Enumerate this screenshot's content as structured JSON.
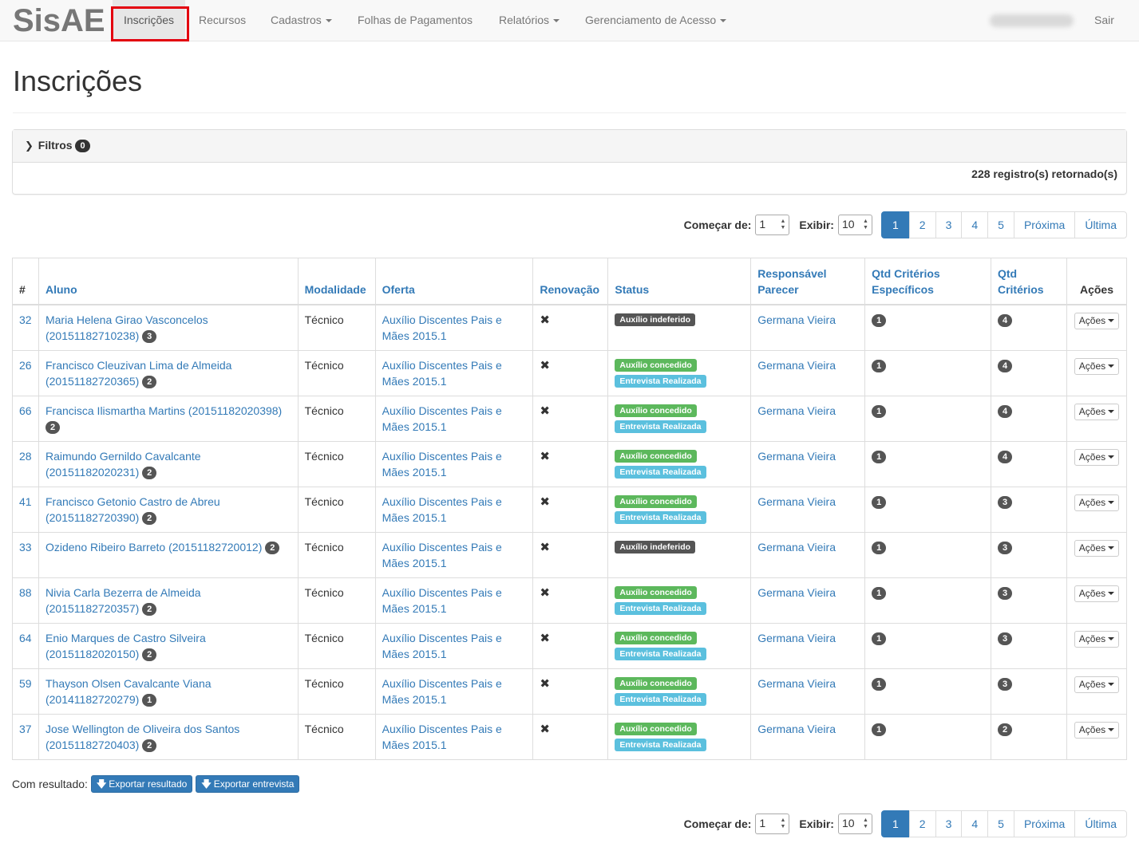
{
  "navbar": {
    "brand": "SisAE",
    "items": [
      {
        "label": "Inscrições",
        "dropdown": false,
        "active": true
      },
      {
        "label": "Recursos",
        "dropdown": false
      },
      {
        "label": "Cadastros",
        "dropdown": true
      },
      {
        "label": "Folhas de Pagamentos",
        "dropdown": false
      },
      {
        "label": "Relatórios",
        "dropdown": true
      },
      {
        "label": "Gerenciamento de Acesso",
        "dropdown": true
      }
    ],
    "logout": "Sair"
  },
  "page": {
    "title": "Inscrições"
  },
  "filters": {
    "label": "Filtros",
    "count": "0",
    "records": "228 registro(s) retornado(s)"
  },
  "pager": {
    "start_label": "Começar de:",
    "start_value": "1",
    "show_label": "Exibir:",
    "show_value": "10",
    "pages": [
      "1",
      "2",
      "3",
      "4",
      "5"
    ],
    "next": "Próxima",
    "last": "Última"
  },
  "table": {
    "headers": {
      "num": "#",
      "aluno": "Aluno",
      "modalidade": "Modalidade",
      "oferta": "Oferta",
      "renovacao": "Renovação",
      "status": "Status",
      "responsavel_l1": "Responsável",
      "responsavel_l2": "Parecer",
      "qtd_esp_l1": "Qtd Critérios",
      "qtd_esp_l2": "Específicos",
      "qtd_l1": "Qtd",
      "qtd_l2": "Critérios",
      "acoes": "Ações"
    },
    "rows": [
      {
        "id": "32",
        "aluno": "Maria Helena Girao Vasconcelos",
        "matricula": "(20151182710238)",
        "badge": "3",
        "modalidade": "Técnico",
        "oferta": "Auxílio Discentes Pais e Mães 2015.1",
        "renovacao": "✖",
        "status": [
          "Auxílio indeferido"
        ],
        "responsavel": "Germana Vieira",
        "qtd_esp": "1",
        "qtd": "4",
        "acoes": "Ações"
      },
      {
        "id": "26",
        "aluno": "Francisco Cleuzivan Lima de Almeida",
        "matricula": "(20151182720365)",
        "badge": "2",
        "modalidade": "Técnico",
        "oferta": "Auxílio Discentes Pais e Mães 2015.1",
        "renovacao": "✖",
        "status": [
          "Auxílio concedido",
          "Entrevista Realizada"
        ],
        "responsavel": "Germana Vieira",
        "qtd_esp": "1",
        "qtd": "4",
        "acoes": "Ações"
      },
      {
        "id": "66",
        "aluno": "Francisca Ilismartha Martins",
        "matricula": "(20151182020398)",
        "badge": "2",
        "modalidade": "Técnico",
        "oferta": "Auxílio Discentes Pais e Mães 2015.1",
        "renovacao": "✖",
        "status": [
          "Auxílio concedido",
          "Entrevista Realizada"
        ],
        "responsavel": "Germana Vieira",
        "qtd_esp": "1",
        "qtd": "4",
        "acoes": "Ações"
      },
      {
        "id": "28",
        "aluno": "Raimundo Gernildo Cavalcante",
        "matricula": "(20151182020231)",
        "badge": "2",
        "modalidade": "Técnico",
        "oferta": "Auxílio Discentes Pais e Mães 2015.1",
        "renovacao": "✖",
        "status": [
          "Auxílio concedido",
          "Entrevista Realizada"
        ],
        "responsavel": "Germana Vieira",
        "qtd_esp": "1",
        "qtd": "4",
        "acoes": "Ações"
      },
      {
        "id": "41",
        "aluno": "Francisco Getonio Castro de Abreu",
        "matricula": "(20151182720390)",
        "badge": "2",
        "modalidade": "Técnico",
        "oferta": "Auxílio Discentes Pais e Mães 2015.1",
        "renovacao": "✖",
        "status": [
          "Auxílio concedido",
          "Entrevista Realizada"
        ],
        "responsavel": "Germana Vieira",
        "qtd_esp": "1",
        "qtd": "3",
        "acoes": "Ações"
      },
      {
        "id": "33",
        "aluno": "Ozideno Ribeiro Barreto",
        "matricula": "(20151182720012)",
        "badge": "2",
        "modalidade": "Técnico",
        "oferta": "Auxílio Discentes Pais e Mães 2015.1",
        "renovacao": "✖",
        "status": [
          "Auxílio indeferido"
        ],
        "responsavel": "Germana Vieira",
        "qtd_esp": "1",
        "qtd": "3",
        "acoes": "Ações"
      },
      {
        "id": "88",
        "aluno": "Nivia Carla Bezerra de Almeida",
        "matricula": "(20151182720357)",
        "badge": "2",
        "modalidade": "Técnico",
        "oferta": "Auxílio Discentes Pais e Mães 2015.1",
        "renovacao": "✖",
        "status": [
          "Auxílio concedido",
          "Entrevista Realizada"
        ],
        "responsavel": "Germana Vieira",
        "qtd_esp": "1",
        "qtd": "3",
        "acoes": "Ações"
      },
      {
        "id": "64",
        "aluno": "Enio Marques de Castro Silveira",
        "matricula": "(20151182020150)",
        "badge": "2",
        "modalidade": "Técnico",
        "oferta": "Auxílio Discentes Pais e Mães 2015.1",
        "renovacao": "✖",
        "status": [
          "Auxílio concedido",
          "Entrevista Realizada"
        ],
        "responsavel": "Germana Vieira",
        "qtd_esp": "1",
        "qtd": "3",
        "acoes": "Ações"
      },
      {
        "id": "59",
        "aluno": "Thayson Olsen Cavalcante Viana",
        "matricula": "(20141182720279)",
        "badge": "1",
        "modalidade": "Técnico",
        "oferta": "Auxílio Discentes Pais e Mães 2015.1",
        "renovacao": "✖",
        "status": [
          "Auxílio concedido",
          "Entrevista Realizada"
        ],
        "responsavel": "Germana Vieira",
        "qtd_esp": "1",
        "qtd": "3",
        "acoes": "Ações"
      },
      {
        "id": "37",
        "aluno": "Jose Wellington de Oliveira dos Santos",
        "matricula": "(20151182720403)",
        "badge": "2",
        "modalidade": "Técnico",
        "oferta": "Auxílio Discentes Pais e Mães 2015.1",
        "renovacao": "✖",
        "status": [
          "Auxílio concedido",
          "Entrevista Realizada"
        ],
        "responsavel": "Germana Vieira",
        "qtd_esp": "1",
        "qtd": "2",
        "acoes": "Ações"
      }
    ]
  },
  "export": {
    "label": "Com resultado:",
    "btn_result": "Exportar resultado",
    "btn_interview": "Exportar entrevista"
  },
  "colors": {
    "primary": "#337ab7",
    "success": "#5cb85c",
    "info": "#5bc0de",
    "default_label": "#555555",
    "highlight": "#e3000f"
  }
}
